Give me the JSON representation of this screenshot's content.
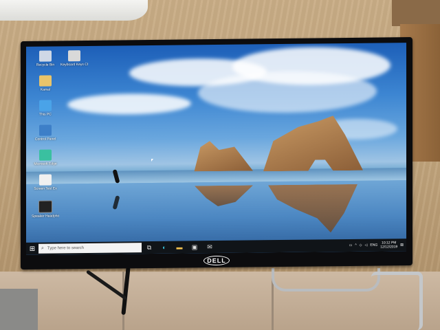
{
  "desktop_icons": [
    {
      "label": "Recycle Bin",
      "icon": "recycle-bin-icon",
      "color": "#cfd8e6"
    },
    {
      "label": "Keyboard Keys Checker",
      "icon": "keyboard-icon",
      "color": "#d9d9d9"
    },
    {
      "label": "Kamal",
      "icon": "user-folder-icon",
      "color": "#e9c46a"
    },
    {
      "label": "This PC",
      "icon": "computer-icon",
      "color": "#4aa3e8"
    },
    {
      "label": "Control Panel",
      "icon": "control-panel-icon",
      "color": "#3d7fc8"
    },
    {
      "label": "Microsoft Edge",
      "icon": "edge-icon",
      "color": "#3ac0a0"
    },
    {
      "label": "Screen Test Ex",
      "icon": "screen-test-icon",
      "color": "#f0f0f0"
    },
    {
      "label": "Speaker Headphone",
      "icon": "speaker-icon",
      "color": "#222222"
    }
  ],
  "taskbar": {
    "start_icon": "windows-start-icon",
    "search_placeholder": "Type here to search",
    "pinned": [
      {
        "name": "task-view",
        "icon": "task-view-icon",
        "glyph": "⧉"
      },
      {
        "name": "edge",
        "icon": "edge-icon",
        "glyph": "◐"
      },
      {
        "name": "file-explorer",
        "icon": "folder-icon",
        "glyph": "▬"
      },
      {
        "name": "store",
        "icon": "store-icon",
        "glyph": "▣"
      },
      {
        "name": "mail",
        "icon": "mail-icon",
        "glyph": "✉"
      }
    ],
    "tray": {
      "language": "ENG",
      "time": "10:12 PM",
      "date": "12/12/2019"
    }
  },
  "bezel": {
    "brand": "DELL"
  },
  "colors": {
    "taskbar_bg": "#101418",
    "sky": "#3d86d2",
    "rock": "#c99a64"
  }
}
